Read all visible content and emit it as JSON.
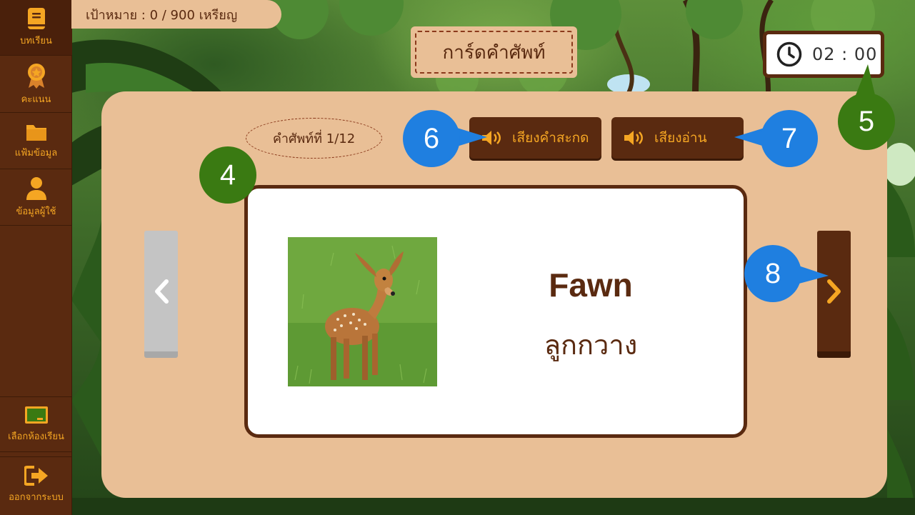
{
  "goal": {
    "text": "เป้าหมาย : 0 / 900 เหรียญ"
  },
  "page": {
    "title": "การ์ดคำศัพท์"
  },
  "timer": {
    "time": "02 : 00",
    "icon": "clock-icon"
  },
  "sidebar": {
    "items": [
      {
        "label": "บทเรียน",
        "icon": "book-icon",
        "active": true
      },
      {
        "label": "คะแนน",
        "icon": "medal-icon"
      },
      {
        "label": "แฟ้มข้อมูล",
        "icon": "folder-icon"
      },
      {
        "label": "ข้อมูลผู้ใช้",
        "icon": "user-icon"
      }
    ],
    "bottom": [
      {
        "label": "เลือกห้องเรียน",
        "icon": "classroom-board-icon"
      },
      {
        "label": "ออกจากระบบ",
        "icon": "logout-icon"
      }
    ]
  },
  "flashcard": {
    "counter": "คำศัพท์ที่ 1/12",
    "spell_sound_label": "เสียงคำสะกด",
    "read_sound_label": "เสียงอ่าน",
    "word_en": "Fawn",
    "word_th": "ลูกกวาง",
    "image": "fawn-photo"
  },
  "callouts": [
    "4",
    "5",
    "6",
    "7",
    "8"
  ],
  "colors": {
    "brown": "#5a2a10",
    "panel": "#e9bf96",
    "accent": "#f5a623",
    "callout_green": "#3a7a12",
    "callout_blue": "#1f7fe0"
  }
}
